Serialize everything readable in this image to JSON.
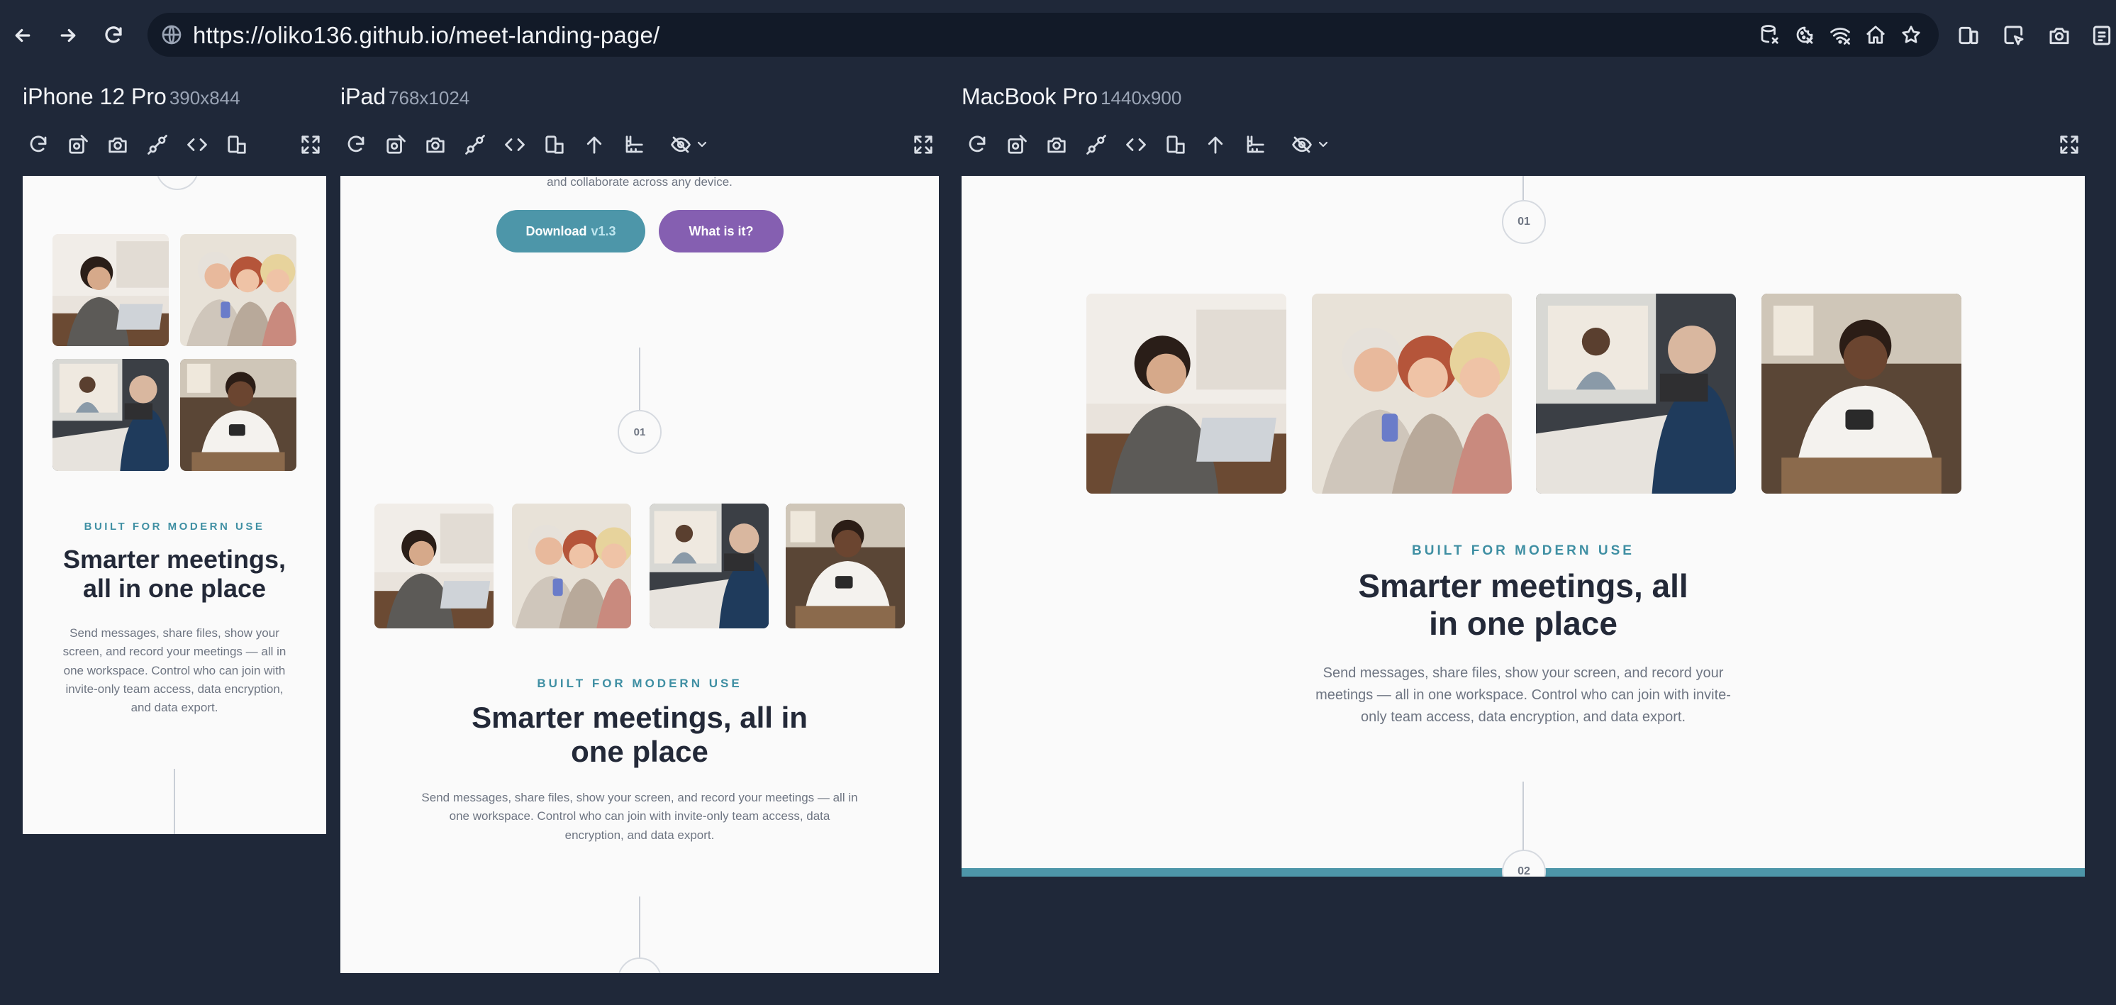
{
  "browser": {
    "url": "https://oliko136.github.io/meet-landing-page/",
    "nav_icons": [
      "back-arrow-icon",
      "forward-arrow-icon",
      "reload-icon"
    ],
    "url_icons": [
      "database-icon",
      "no-cookies-icon",
      "wifi-off-icon",
      "home-icon",
      "star-icon"
    ],
    "right_icons": [
      "responsive-devices-icon",
      "select-cursor-icon",
      "camera-icon",
      "extension-icon"
    ]
  },
  "devices": [
    {
      "name": "iPhone 12 Pro",
      "size": "390x844"
    },
    {
      "name": "iPad",
      "size": "768x1024"
    },
    {
      "name": "MacBook Pro",
      "size": "1440x900"
    }
  ],
  "page": {
    "top_text": "and collaborate across any device.",
    "download_label": "Download",
    "download_version": "v1.3",
    "whatis_label": "What is it?",
    "step1": "01",
    "step2": "02",
    "eyebrow": "BUILT FOR MODERN USE",
    "heading": "Smarter meetings, all in one place",
    "body": "Send messages, share files, show your screen, and record your meetings — all in one workspace. Control who can join with invite-only team access, data encryption, and data export."
  },
  "colors": {
    "background": "#1f2839",
    "page": "#fafafa",
    "accent_teal": "#4d96a9",
    "accent_purple": "#855fb1",
    "heading": "#232938"
  }
}
